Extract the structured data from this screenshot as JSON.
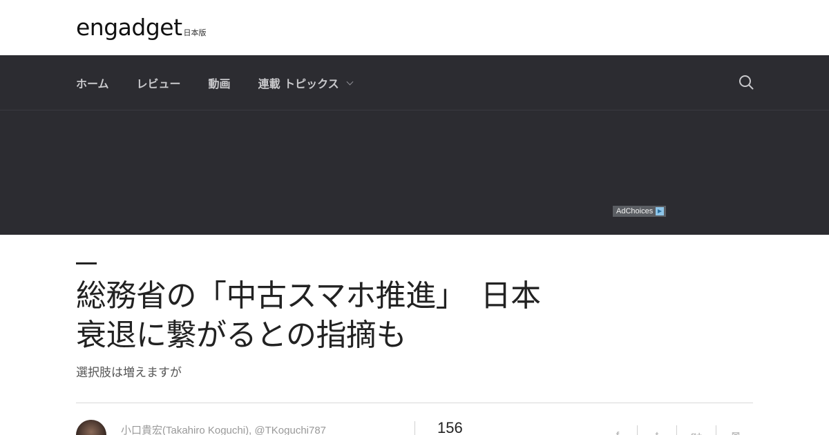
{
  "header": {
    "logo_text": "engadget",
    "logo_sub": "日本版"
  },
  "nav": {
    "items": [
      {
        "label": "ホーム"
      },
      {
        "label": "レビュー"
      },
      {
        "label": "動画"
      },
      {
        "label": "連載 トピックス"
      }
    ],
    "search_icon": "search-icon"
  },
  "ad": {
    "adchoices_label": "AdChoices"
  },
  "article": {
    "title_line1": "総務省の「中古スマホ推進」　日本",
    "title_line2": "衰退に繋がるとの指摘も",
    "subtitle": "選択肢は増えますが",
    "author": "小口貴宏(Takahiro Koguchi), @TKoguchi787",
    "share_count": "156",
    "share_icons": [
      "facebook-icon",
      "twitter-icon",
      "google-plus-icon",
      "email-icon"
    ],
    "share_glyphs": {
      "facebook": "f",
      "twitter": "t",
      "google_plus": "g+",
      "email": "✉"
    }
  },
  "colors": {
    "nav_bg": "#2c2c31",
    "nav_text": "#c9c9cc",
    "headline": "#222222",
    "byline": "#999999"
  }
}
